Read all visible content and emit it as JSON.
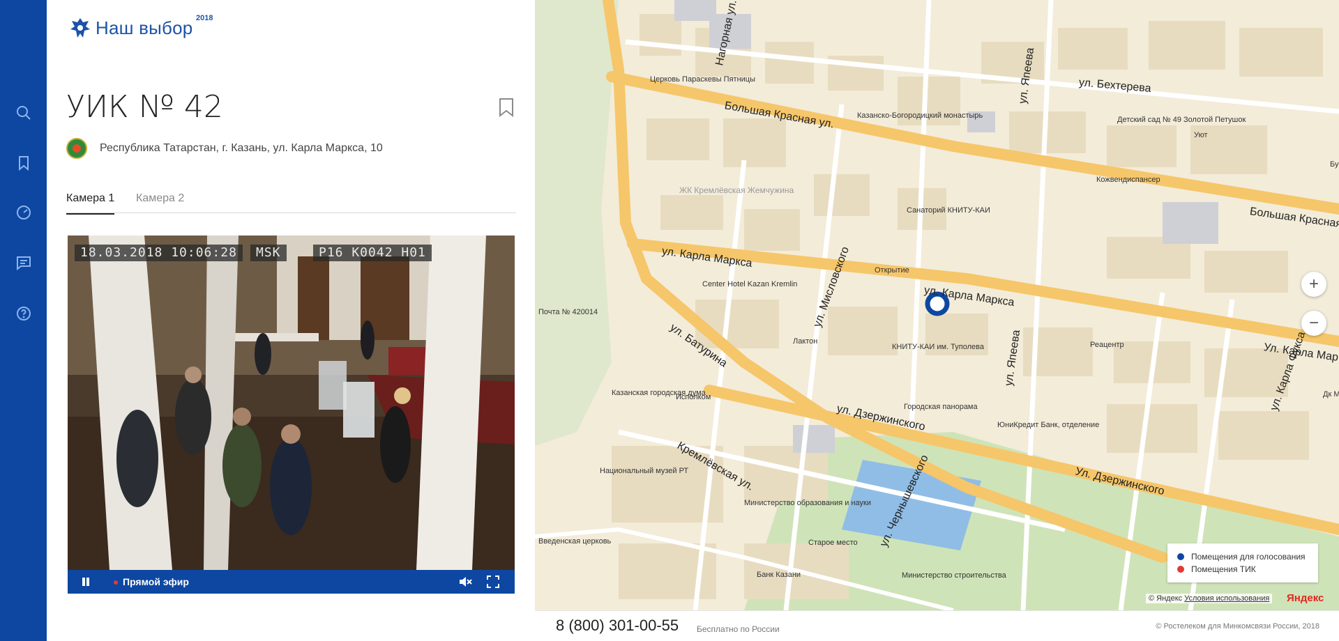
{
  "logo": {
    "text": "Наш выбор",
    "year": "2018"
  },
  "rail": {
    "items": [
      "search-icon",
      "bookmark-icon",
      "dashboard-icon",
      "chat-icon",
      "help-icon"
    ]
  },
  "station": {
    "title": "УИК № 42",
    "address": "Республика Татарстан, г. Казань, ул. Карла Маркса, 10"
  },
  "tabs": [
    {
      "label": "Камера 1",
      "active": true
    },
    {
      "label": "Камера 2",
      "active": false
    }
  ],
  "video": {
    "timestamp": "18.03.2018 10:06:28",
    "timezone": "MSK",
    "camera_id": "P16 K0042 H01",
    "live_label": "Прямой эфир"
  },
  "map": {
    "streets": [
      "Большая Красная ул.",
      "ул. Карла Маркса",
      "ул. Батурина",
      "ул. Дзержинского",
      "Кремлёвская ул.",
      "ул. Мисловского",
      "ул. Япеева",
      "ул. Бехтерева",
      "Нагорная ул.",
      "ул. Чернышевского",
      "Большая Красная",
      "Ул. Карла Мар",
      "Ул. Дзержинского",
      "ул. Япеева",
      "ул. Карла Фукса"
    ],
    "labels": [
      "Церковь Параскевы Пятницы",
      "Казанско-Богородицкий монастырь",
      "Детский сад № 49 Золотой Петушок",
      "Уют",
      "Буфет Ко",
      "Кожвендиспансер",
      "Санаторий КНИТУ-КАИ",
      "ЖК Кремлёвская Жемчужина",
      "Открытие",
      "Center Hotel Kazan Kremlin",
      "Почта № 420014",
      "Лактон",
      "КНИТУ-КАИ им. Туполева",
      "Реацентр",
      "Казанская городская дума",
      "Исполком",
      "Городская панорама",
      "ЮниКредит Банк, отделение",
      "Национальный музей РТ",
      "Министерство образования и науки",
      "Старое место",
      "Банк Казани",
      "Министерство строительства",
      "Введенская церковь",
      "Дк Ме"
    ],
    "legend": [
      {
        "label": "Помещения для голосования",
        "color": "#0d47a1"
      },
      {
        "label": "Помещения ТИК",
        "color": "#e53935"
      }
    ],
    "copyright": "© Яндекс",
    "terms": "Условия использования",
    "brand": "Яндекс"
  },
  "footer": {
    "phone": "8 (800) 301-00-55",
    "phone_note": "Бесплатно по России",
    "copyright": "© Ростелеком для Минкомсвязи России, 2018"
  }
}
